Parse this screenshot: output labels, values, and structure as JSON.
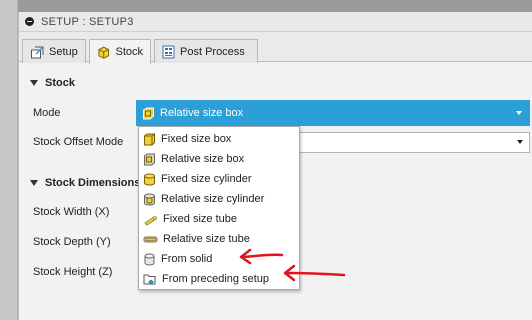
{
  "window": {
    "title": "SETUP : SETUP3"
  },
  "tabs": [
    {
      "label": "Setup",
      "icon": "setup-icon",
      "active": false
    },
    {
      "label": "Stock",
      "icon": "stock-cube-icon",
      "active": true
    },
    {
      "label": "Post Process",
      "icon": "post-process-icon",
      "active": false
    }
  ],
  "stock_section": {
    "title": "Stock"
  },
  "fields": {
    "mode_label": "Mode",
    "mode_value": "Relative size box",
    "offset_mode_label": "Stock Offset Mode"
  },
  "dimensions_section": {
    "title": "Stock Dimensions",
    "width_label": "Stock Width (X)",
    "depth_label": "Stock Depth (Y)",
    "height_label": "Stock Height (Z)"
  },
  "dropdown": {
    "options": [
      {
        "label": "Fixed size box",
        "icon": "fixed-box-icon"
      },
      {
        "label": "Relative size box",
        "icon": "relative-box-icon"
      },
      {
        "label": "Fixed size cylinder",
        "icon": "fixed-cylinder-icon"
      },
      {
        "label": "Relative size cylinder",
        "icon": "relative-cylinder-icon"
      },
      {
        "label": "Fixed size tube",
        "icon": "fixed-tube-icon"
      },
      {
        "label": "Relative size tube",
        "icon": "relative-tube-icon"
      },
      {
        "label": "From solid",
        "icon": "solid-icon"
      },
      {
        "label": "From preceding setup",
        "icon": "preceding-setup-icon"
      }
    ]
  },
  "colors": {
    "accent": "#2c9fd9",
    "icon_yellow": "#f2cf3e",
    "annotation_red": "#e0141e"
  }
}
